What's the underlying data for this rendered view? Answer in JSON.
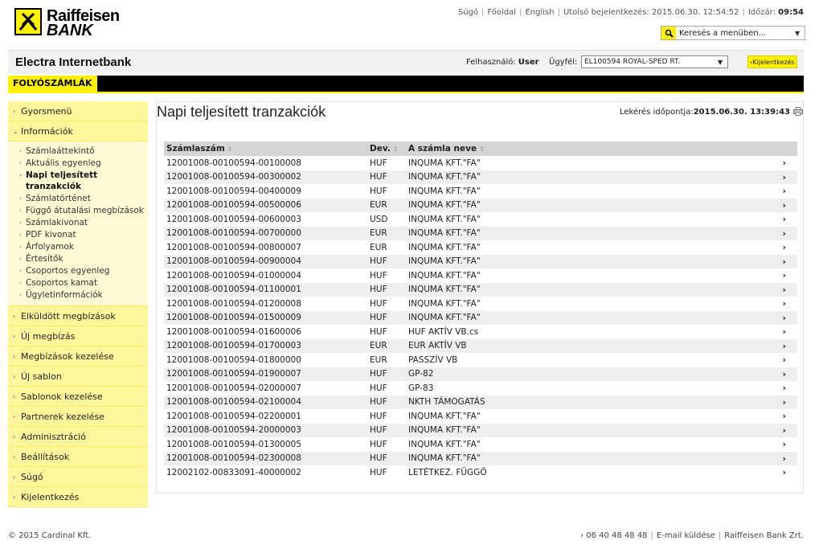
{
  "brand": {
    "line1": "Raiffeisen",
    "line2": "BANK"
  },
  "toplinks": {
    "help": "Súgó",
    "home": "Főoldal",
    "english": "English",
    "last_login_label": "Utolsó bejelentkezés: 2015.06.30. 12:54:52",
    "timer_label": "Időzár:",
    "timer_value": "09:54"
  },
  "menu_search": {
    "value": "Keresés a menüben..."
  },
  "appbar": {
    "title": "Electra Internetbank",
    "user_label": "Felhasználó:",
    "user_value": "User",
    "client_label": "Ügyfél:",
    "client_value": "EL100594 ROYAL-SPED RT.",
    "logout_label": "Kijelentkezés"
  },
  "navbar": {
    "tab": "FOLYÓSZÁMLÁK"
  },
  "sidebar": {
    "quick": "Gyorsmenü",
    "info": "Információk",
    "subitems": [
      "Számlaáttekintő",
      "Aktuális egyenleg",
      "Napi teljesített tranzakciók",
      "Számlatörténet",
      "Függő átutalási megbízások",
      "Számlakivonat",
      "PDF kivonat",
      "Árfolyamok",
      "Értesítők",
      "Csoportos egyenleg",
      "Csoportos kamat",
      "Ügyletinformációk"
    ],
    "items": [
      "Elküldött megbízások",
      "Új megbízás",
      "Megbízások kezelése",
      "Új sablon",
      "Sablonok kezelése",
      "Partnerek kezelése",
      "Adminisztráció",
      "Beállítások",
      "Súgó",
      "Kijelentkezés"
    ]
  },
  "main": {
    "title": "Napi teljesített tranzakciók",
    "query_label": "Lekérés időpontja:",
    "query_value": "2015.06.30. 13:39:43",
    "columns": [
      "Számlaszám",
      "Dev.",
      "A számla neve"
    ],
    "rows": [
      [
        "12001008-00100594-00100008",
        "HUF",
        "INQUMA KFT.\"FA\""
      ],
      [
        "12001008-00100594-00300002",
        "HUF",
        "INQUMA KFT.\"FA\""
      ],
      [
        "12001008-00100594-00400009",
        "HUF",
        "INQUMA KFT.\"FA\""
      ],
      [
        "12001008-00100594-00500006",
        "EUR",
        "INQUMA KFT.\"FA\""
      ],
      [
        "12001008-00100594-00600003",
        "USD",
        "INQUMA KFT.\"FA\""
      ],
      [
        "12001008-00100594-00700000",
        "EUR",
        "INQUMA KFT.\"FA\""
      ],
      [
        "12001008-00100594-00800007",
        "EUR",
        "INQUMA KFT.\"FA\""
      ],
      [
        "12001008-00100594-00900004",
        "HUF",
        "INQUMA KFT.\"FA\""
      ],
      [
        "12001008-00100594-01000004",
        "HUF",
        "INQUMA KFT.\"FA\""
      ],
      [
        "12001008-00100594-01100001",
        "HUF",
        "INQUMA KFT.\"FA\""
      ],
      [
        "12001008-00100594-01200008",
        "HUF",
        "INQUMA KFT.\"FA\""
      ],
      [
        "12001008-00100594-01500009",
        "HUF",
        "INQUMA KFT.\"FA\""
      ],
      [
        "12001008-00100594-01600006",
        "HUF",
        "HUF AKTÍV VB.cs"
      ],
      [
        "12001008-00100594-01700003",
        "EUR",
        "EUR AKTÍV VB"
      ],
      [
        "12001008-00100594-01800000",
        "EUR",
        "PASSZÍV VB"
      ],
      [
        "12001008-00100594-01900007",
        "HUF",
        "GP-82"
      ],
      [
        "12001008-00100594-02000007",
        "HUF",
        "GP-83"
      ],
      [
        "12001008-00100594-02100004",
        "HUF",
        "NKTH TÁMOGATÁS"
      ],
      [
        "12001008-00100594-02200001",
        "HUF",
        "INQUMA KFT.\"FA\""
      ],
      [
        "12001008-00100594-20000003",
        "HUF",
        "INQUMA KFT.\"FA\""
      ],
      [
        "12001008-00100594-01300005",
        "HUF",
        "INQUMA KFT.\"FA\""
      ],
      [
        "12001008-00100594-02300008",
        "HUF",
        "INQUMA KFT.\"FA\""
      ],
      [
        "12002102-00833091-40000002",
        "HUF",
        "LETÉTKEZ. FÜGGŐ"
      ]
    ]
  },
  "footer": {
    "copyright": "© 2015 Cardinal Kft.",
    "phone": "06 40 48 48 48",
    "email": "E-mail küldése",
    "company": "Raiffeisen Bank Zrt."
  }
}
